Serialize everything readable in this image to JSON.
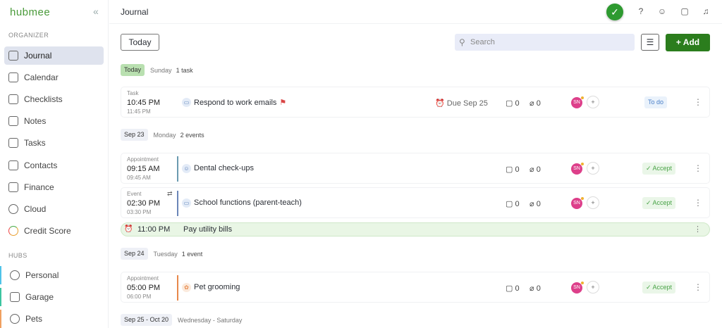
{
  "sidebar": {
    "logo": "hubmee",
    "collapse": "«",
    "organizer_label": "ORGANIZER",
    "hubs_label": "HUBS",
    "items": [
      {
        "label": "Journal",
        "icon": "clipboard-icon"
      },
      {
        "label": "Calendar",
        "icon": "calendar-icon"
      },
      {
        "label": "Checklists",
        "icon": "checklist-icon"
      },
      {
        "label": "Notes",
        "icon": "notes-icon"
      },
      {
        "label": "Tasks",
        "icon": "tasks-icon"
      },
      {
        "label": "Contacts",
        "icon": "contacts-icon"
      },
      {
        "label": "Finance",
        "icon": "finance-icon"
      },
      {
        "label": "Cloud",
        "icon": "cloud-icon"
      },
      {
        "label": "Credit Score",
        "icon": "gauge-icon"
      }
    ],
    "hubs": [
      {
        "label": "Personal",
        "color": "#4fc3e8"
      },
      {
        "label": "Garage",
        "color": "#3cc4a0"
      },
      {
        "label": "Pets",
        "color": "#f0a060"
      }
    ]
  },
  "header": {
    "title": "Journal"
  },
  "toolbar": {
    "today": "Today",
    "search_placeholder": "Search",
    "add": "Add"
  },
  "groups": [
    {
      "date": "Today",
      "day": "Sunday",
      "count": "1 task"
    },
    {
      "date": "Sep 23",
      "day": "Monday",
      "count": "2 events"
    },
    {
      "date": "Sep 24",
      "day": "Tuesday",
      "count": "1 event"
    },
    {
      "date": "Sep 25 - Oct 20",
      "day": "Wednesday - Saturday"
    }
  ],
  "rows": [
    {
      "kind": "Task",
      "start": "10:45 PM",
      "end": "11:45 PM",
      "name": "Respond to work emails",
      "due": "Due Sep 25",
      "comments": "0",
      "attachments": "0",
      "avatar": "SN",
      "status": "To do"
    },
    {
      "kind": "Appointment",
      "start": "09:15 AM",
      "end": "09:45 AM",
      "name": "Dental check-ups",
      "comments": "0",
      "attachments": "0",
      "avatar": "SN",
      "status": "Accept"
    },
    {
      "kind": "Event",
      "start": "02:30 PM",
      "end": "03:30 PM",
      "name": "School functions (parent-teach)",
      "comments": "0",
      "attachments": "0",
      "avatar": "SN",
      "status": "Accept"
    },
    {
      "kind": "Appointment",
      "start": "05:00 PM",
      "end": "06:00 PM",
      "name": "Pet grooming",
      "comments": "0",
      "attachments": "0",
      "avatar": "SN",
      "status": "Accept"
    }
  ],
  "reminder": {
    "time": "11:00 PM",
    "name": "Pay utility bills"
  }
}
